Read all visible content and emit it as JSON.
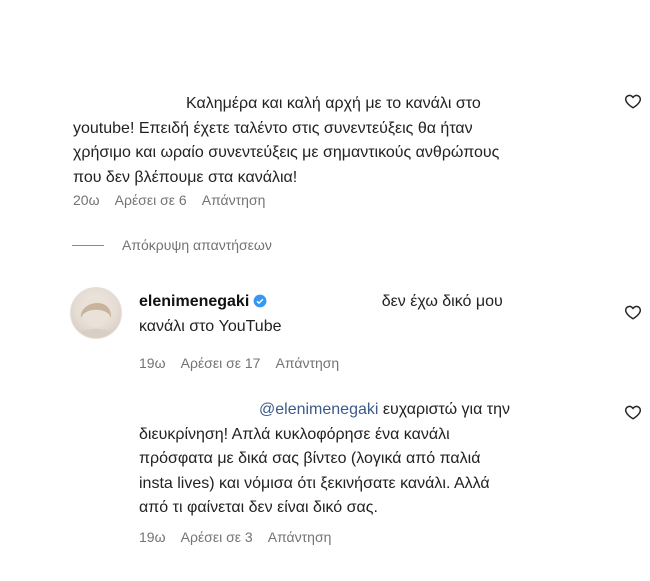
{
  "comments": [
    {
      "text_lines": [
        "Καλημέρα και καλή αρχή με το κανάλι στο",
        "youtube! Επειδή έχετε ταλέντο στις συνεντεύξεις θα ήταν",
        "χρήσιμο και ωραίο συνεντεύξεις με σημαντικούς ανθρώπους",
        "που δεν βλέπουμε στα κανάλια!"
      ],
      "time": "20ω",
      "likes": "Αρέσει σε 6",
      "reply": "Απάντηση"
    },
    {
      "username": "elenimenegaki",
      "text_inline": "δεν έχω δικό μου",
      "text_line2": "κανάλι στο YouTube",
      "time": "19ω",
      "likes": "Αρέσει σε 17",
      "reply": "Απάντηση"
    },
    {
      "mention": "@elenimenegaki",
      "text_line1_rest": " ευχαριστώ για την",
      "text_lines": [
        "διευκρίνηση! Απλά κυκλοφόρησε ένα κανάλι",
        "πρόσφατα με δικά σας βίντεο (λογικά από παλιά",
        "insta lives) και νόμισα ότι ξεκινήσατε κανάλι. Αλλά",
        "από τι φαίνεται δεν είναι δικό σας."
      ],
      "time": "19ω",
      "likes": "Αρέσει σε 3",
      "reply": "Απάντηση"
    }
  ],
  "hide_replies": "Απόκρυψη απαντήσεων",
  "icons": {
    "like": "heart-outline-icon",
    "verified": "verified-badge-icon"
  },
  "colors": {
    "verified": "#3897f0",
    "meta": "#737373",
    "mention": "#3b5a8a"
  }
}
